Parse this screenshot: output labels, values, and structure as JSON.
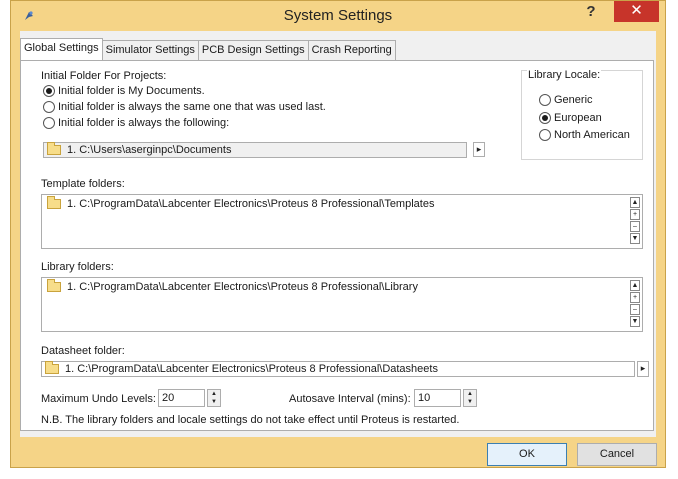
{
  "window": {
    "title": "System Settings",
    "help_label": "?",
    "close_label": "✕"
  },
  "tabs": [
    {
      "label": "Global Settings",
      "active": true
    },
    {
      "label": "Simulator Settings",
      "active": false
    },
    {
      "label": "PCB Design Settings",
      "active": false
    },
    {
      "label": "Crash Reporting",
      "active": false
    }
  ],
  "initial_folder": {
    "label": "Initial Folder For Projects:",
    "options": [
      {
        "label": "Initial folder is My Documents.",
        "checked": true
      },
      {
        "label": "Initial folder is always the same one that was used last.",
        "checked": false
      },
      {
        "label": "Initial folder is always the following:",
        "checked": false
      }
    ],
    "path": "1.  C:\\Users\\aserginpc\\Documents",
    "browse_icon": "arrow-right-icon"
  },
  "library_locale": {
    "label": "Library Locale:",
    "options": [
      {
        "label": "Generic",
        "checked": false
      },
      {
        "label": "European",
        "checked": true
      },
      {
        "label": "North American",
        "checked": false
      }
    ]
  },
  "template_folders": {
    "label": "Template folders:",
    "items": [
      "1.  C:\\ProgramData\\Labcenter Electronics\\Proteus 8 Professional\\Templates"
    ]
  },
  "library_folders": {
    "label": "Library folders:",
    "items": [
      "1.  C:\\ProgramData\\Labcenter Electronics\\Proteus 8 Professional\\Library"
    ]
  },
  "datasheet_folder": {
    "label": "Datasheet folder:",
    "path": "1.  C:\\ProgramData\\Labcenter Electronics\\Proteus 8 Professional\\Datasheets"
  },
  "undo": {
    "label": "Maximum Undo Levels:",
    "value": "20"
  },
  "autosave": {
    "label": "Autosave Interval (mins):",
    "value": "10"
  },
  "note": "N.B. The library folders and locale settings do not take effect until Proteus is restarted.",
  "footer": {
    "ok_label": "OK",
    "cancel_label": "Cancel"
  },
  "colors": {
    "title_bar": "#f5d487",
    "close_button": "#c7342a",
    "panel": "#ffffff",
    "dialog_bg": "#f0f0f0"
  }
}
